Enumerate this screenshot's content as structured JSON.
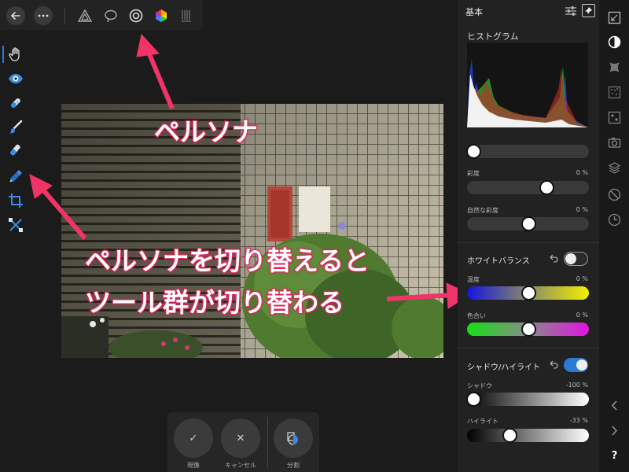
{
  "annotations": {
    "persona": "ペルソナ",
    "switch_line1": "ペルソナを切り替えると",
    "switch_line2": "ツール群が切り替わる"
  },
  "panel": {
    "title": "基本",
    "histogram_label": "ヒストグラム",
    "rows": [
      {
        "label": "",
        "value": "",
        "knob": 0.05
      },
      {
        "label": "彩度",
        "value": "0 %",
        "knob": 0.65
      },
      {
        "label": "自然な彩度",
        "value": "0 %",
        "knob": 0.5
      }
    ],
    "white_balance": {
      "title": "ホワイトバランス",
      "enabled": false,
      "temperature": {
        "label": "温度",
        "value": "0 %",
        "knob": 0.5
      },
      "tint": {
        "label": "色合い",
        "value": "0 %",
        "knob": 0.5
      }
    },
    "shadows_highlights": {
      "title": "シャドウ/ハイライト",
      "enabled": true,
      "shadows": {
        "label": "シャドウ",
        "value": "-100 %",
        "knob": 0.05
      },
      "highlights": {
        "label": "ハイライト",
        "value": "-33 %",
        "knob": 0.35
      }
    }
  },
  "bottom_bar": {
    "develop_label": "現像",
    "cancel_label": "キャンセル",
    "split_label": "分割"
  },
  "icons": {
    "left_tools": [
      "hand-icon",
      "eye-icon",
      "retouch-icon",
      "brush-icon",
      "overlay-brush-icon",
      "picker-icon",
      "crop-icon",
      "transform-icon"
    ],
    "personas": [
      "photo-persona-icon",
      "liquify-persona-icon",
      "develop-persona-icon",
      "tonemap-persona-icon",
      "export-persona-icon"
    ]
  },
  "colors": {
    "accent": "#2b7bd6",
    "annotation": "#e0225a"
  }
}
